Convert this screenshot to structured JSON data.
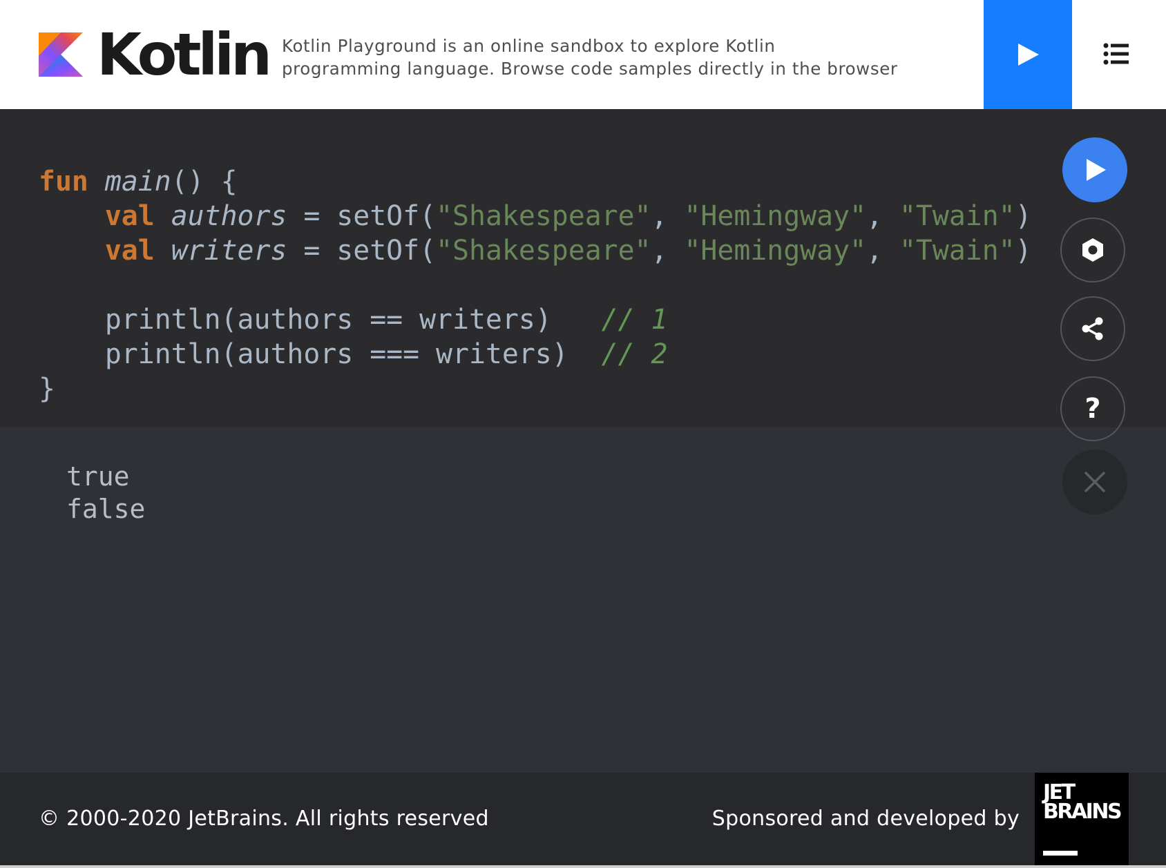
{
  "header": {
    "logo_text": "Kotlin",
    "tagline_line1": "Kotlin Playground is an online sandbox to explore Kotlin",
    "tagline_line2": "programming language. Browse code samples directly in the browser",
    "run_icon": "play-icon",
    "menu_icon": "list-menu-icon",
    "accent_color": "#167dff"
  },
  "code": {
    "l1": {
      "kw": "fun",
      "name": "main",
      "rest": "() {"
    },
    "l2": {
      "kw": "val",
      "name": "authors",
      "eq": " = setOf(",
      "s1": "\"Shakespeare\"",
      "c1": ", ",
      "s2": "\"Hemingway\"",
      "c2": ", ",
      "s3": "\"Twain\"",
      "end": ")"
    },
    "l3": {
      "kw": "val",
      "name": "writers",
      "eq": " = setOf(",
      "s1": "\"Shakespeare\"",
      "c1": ", ",
      "s2": "\"Hemingway\"",
      "c2": ", ",
      "s3": "\"Twain\"",
      "end": ")"
    },
    "l5": {
      "text": "println(authors == writers)   ",
      "comment": "// 1"
    },
    "l6": {
      "text": "println(authors === writers)  ",
      "comment": "// 2"
    },
    "l7": "}",
    "indent": "    "
  },
  "output": {
    "lines": [
      "true",
      "false"
    ]
  },
  "side_buttons": {
    "run_icon": "play-icon",
    "settings_icon": "hexagon-settings-icon",
    "share_icon": "share-icon",
    "help_icon": "question-icon",
    "help_glyph": "?",
    "close_icon": "close-icon"
  },
  "footer": {
    "copyright": "© 2000-2020 JetBrains. All rights reserved",
    "sponsor": "Sponsored and developed by",
    "jb_line1": "JET",
    "jb_line2": "BRAINS"
  }
}
